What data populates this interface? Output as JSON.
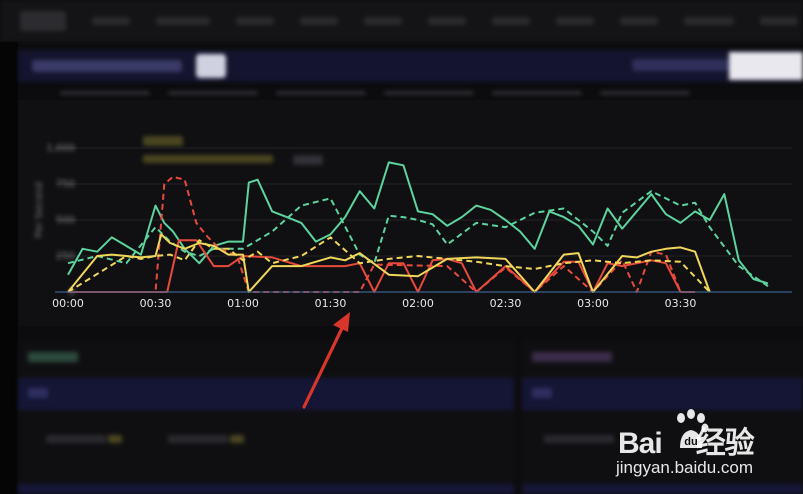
{
  "chart_data": {
    "type": "line",
    "ylabel": "Per Second",
    "xlabel": "",
    "x_ticks": [
      "00:00",
      "00:30",
      "01:00",
      "01:30",
      "02:00",
      "02:30",
      "03:00",
      "03:30"
    ],
    "y_ticks": [
      "0",
      "250",
      "500",
      "750",
      "1,000"
    ],
    "xlim": [
      0,
      240
    ],
    "ylim": [
      0,
      1000
    ],
    "grid": true,
    "series": [
      {
        "color": "#5dd39e",
        "style": "solid",
        "x": [
          0,
          5,
          10,
          15,
          20,
          25,
          30,
          33,
          36,
          40,
          45,
          50,
          55,
          60,
          62,
          65,
          70,
          75,
          80,
          85,
          90,
          95,
          100,
          105,
          110,
          115,
          120,
          125,
          130,
          135,
          140,
          145,
          150,
          155,
          160,
          165,
          170,
          175,
          180,
          185,
          190,
          195,
          200,
          205,
          210,
          215,
          220,
          225,
          230,
          235,
          240
        ],
        "values": [
          120,
          300,
          280,
          380,
          320,
          260,
          600,
          480,
          420,
          300,
          200,
          320,
          350,
          350,
          760,
          780,
          560,
          520,
          480,
          350,
          400,
          520,
          700,
          580,
          900,
          880,
          560,
          540,
          460,
          520,
          600,
          570,
          500,
          420,
          300,
          560,
          520,
          460,
          330,
          580,
          440,
          560,
          680,
          540,
          480,
          560,
          500,
          680,
          220,
          90,
          60
        ]
      },
      {
        "color": "#5dd39e",
        "style": "dashed",
        "x": [
          0,
          10,
          20,
          30,
          35,
          40,
          45,
          50,
          60,
          70,
          80,
          90,
          100,
          105,
          110,
          115,
          120,
          125,
          130,
          140,
          150,
          160,
          170,
          180,
          185,
          190,
          200,
          210,
          215,
          220,
          230,
          240
        ],
        "values": [
          200,
          250,
          200,
          450,
          350,
          280,
          250,
          300,
          300,
          420,
          600,
          650,
          260,
          200,
          530,
          520,
          500,
          470,
          330,
          480,
          450,
          550,
          580,
          420,
          320,
          550,
          700,
          600,
          620,
          450,
          180,
          40
        ]
      },
      {
        "color": "#e84a3c",
        "style": "solid",
        "x": [
          0,
          20,
          30,
          34,
          38,
          40,
          42,
          44,
          50,
          55,
          60,
          70,
          80,
          95,
          100,
          105,
          110,
          115,
          120,
          125,
          130,
          135,
          140,
          150,
          160,
          170,
          175,
          180,
          185,
          190,
          200,
          205,
          210,
          215
        ],
        "values": [
          0,
          0,
          0,
          0,
          360,
          360,
          360,
          360,
          180,
          180,
          250,
          240,
          180,
          180,
          200,
          0,
          200,
          200,
          0,
          220,
          230,
          200,
          0,
          180,
          0,
          210,
          210,
          0,
          200,
          180,
          220,
          200,
          0,
          0
        ]
      },
      {
        "color": "#e84a3c",
        "style": "dashed",
        "x": [
          0,
          30,
          33,
          36,
          40,
          44,
          48,
          52,
          58,
          62,
          100,
          105,
          130,
          140,
          150,
          160,
          170,
          180,
          190,
          195,
          200,
          205,
          210
        ],
        "values": [
          0,
          0,
          750,
          800,
          780,
          480,
          380,
          300,
          250,
          0,
          0,
          190,
          180,
          0,
          170,
          0,
          180,
          0,
          220,
          0,
          280,
          260,
          0
        ]
      },
      {
        "color": "#f0d75a",
        "style": "solid",
        "x": [
          0,
          10,
          15,
          20,
          25,
          30,
          32,
          35,
          40,
          45,
          50,
          55,
          60,
          62,
          70,
          80,
          90,
          95,
          100,
          110,
          120,
          130,
          140,
          150,
          160,
          170,
          175,
          180,
          190,
          195,
          200,
          205,
          210,
          215,
          220
        ],
        "values": [
          0,
          250,
          260,
          250,
          240,
          250,
          400,
          340,
          300,
          340,
          320,
          260,
          260,
          0,
          180,
          180,
          240,
          220,
          270,
          120,
          110,
          230,
          240,
          230,
          0,
          260,
          270,
          0,
          250,
          240,
          280,
          300,
          310,
          280,
          0
        ]
      },
      {
        "color": "#f0d75a",
        "style": "dashed",
        "x": [
          0,
          20,
          25,
          30,
          35,
          40,
          45,
          50,
          55,
          60,
          65,
          70,
          80,
          90,
          100,
          110,
          120,
          130,
          140,
          150,
          160,
          170,
          180,
          190,
          200,
          210,
          220
        ],
        "values": [
          0,
          250,
          230,
          250,
          260,
          220,
          360,
          300,
          300,
          220,
          280,
          200,
          250,
          380,
          200,
          230,
          250,
          230,
          210,
          180,
          160,
          200,
          220,
          200,
          220,
          210,
          0
        ]
      }
    ]
  },
  "watermark": {
    "brand_left": "Bai",
    "brand_right": "经验",
    "site": "jingyan.baidu.com"
  },
  "colors": {
    "accent_navy": "#14142e",
    "arrow_red": "#d9362b"
  }
}
